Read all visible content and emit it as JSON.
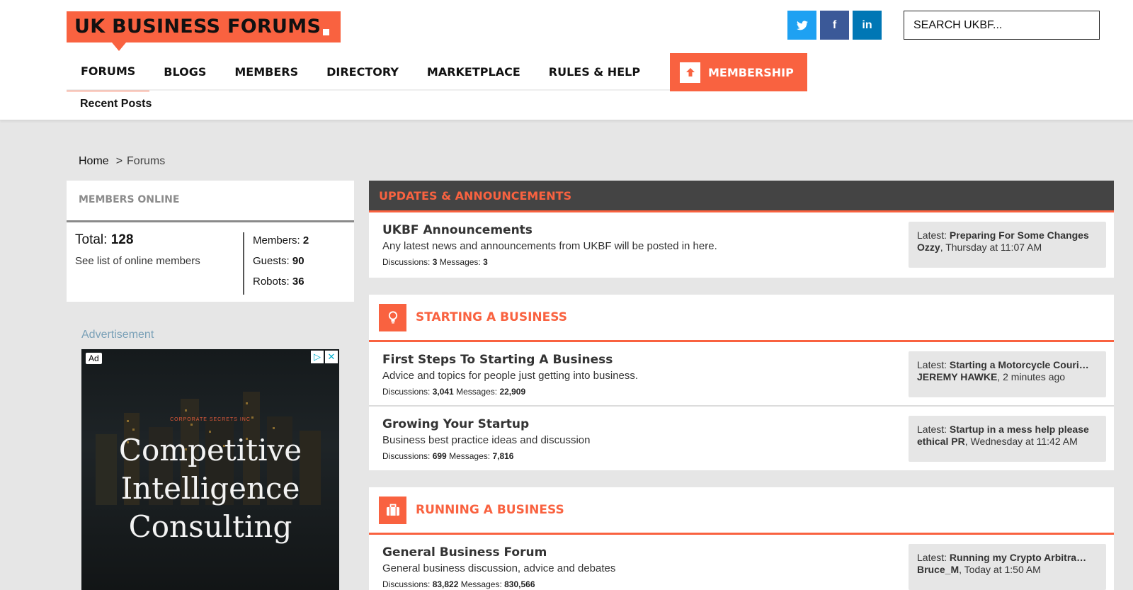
{
  "header": {
    "logo_text": "UK BUSINESS FORUMS",
    "social": {
      "twitter": "t",
      "facebook": "f",
      "linkedin": "in"
    },
    "search_placeholder": "SEARCH UKBF...",
    "nav": [
      {
        "label": "FORUMS"
      },
      {
        "label": "BLOGS"
      },
      {
        "label": "MEMBERS"
      },
      {
        "label": "DIRECTORY"
      },
      {
        "label": "MARKETPLACE"
      },
      {
        "label": "RULES & HELP"
      }
    ],
    "membership_label": "MEMBERSHIP",
    "membership_icon": "arrow-up-icon",
    "subnav": "Recent Posts",
    "accent_color": "#f96240"
  },
  "breadcrumb": {
    "home": "Home",
    "separator": ">",
    "current": "Forums"
  },
  "members_online": {
    "title": "MEMBERS ONLINE",
    "total_label": "Total:",
    "total_value": "128",
    "link": "See list of online members",
    "members_label": "Members:",
    "members_value": "2",
    "guests_label": "Guests:",
    "guests_value": "90",
    "robots_label": "Robots:",
    "robots_value": "36"
  },
  "advertisement": {
    "label": "Advertisement",
    "badge": "Ad",
    "company": "CORPORATE SECRETS INC",
    "line1": "Competitive",
    "line2": "Intelligence",
    "line3": "Consulting"
  },
  "categories": [
    {
      "title": "UPDATES & ANNOUNCEMENTS",
      "forums": [
        {
          "title": "UKBF Announcements",
          "description": "Any latest news and announcements from UKBF will be posted in here.",
          "disc_label": "Discussions:",
          "discussions": "3",
          "msg_label": "Messages:",
          "messages": "3",
          "latest_label": "Latest:",
          "latest_title": "Preparing For Some Changes",
          "latest_user": "Ozzy",
          "latest_time": ", Thursday at 11:07 AM"
        }
      ]
    },
    {
      "title": "STARTING A BUSINESS",
      "icon": "lightbulb-icon",
      "forums": [
        {
          "title": "First Steps To Starting A Business",
          "description": "Advice and topics for people just getting into business.",
          "disc_label": "Discussions:",
          "discussions": "3,041",
          "msg_label": "Messages:",
          "messages": "22,909",
          "latest_label": "Latest:",
          "latest_title": "Starting a Motorcycle Couri…",
          "latest_user": "JEREMY HAWKE",
          "latest_time": ", 2 minutes ago"
        },
        {
          "title": "Growing Your Startup",
          "description": "Business best practice ideas and discussion",
          "disc_label": "Discussions:",
          "discussions": "699",
          "msg_label": "Messages:",
          "messages": "7,816",
          "latest_label": "Latest:",
          "latest_title": "Startup in a mess help please",
          "latest_user": "ethical PR",
          "latest_time": ", Wednesday at 11:42 AM"
        }
      ]
    },
    {
      "title": "RUNNING A BUSINESS",
      "icon": "briefcase-icon",
      "forums": [
        {
          "title": "General Business Forum",
          "description": "General business discussion, advice and debates",
          "disc_label": "Discussions:",
          "discussions": "83,822",
          "msg_label": "Messages:",
          "messages": "830,566",
          "latest_label": "Latest:",
          "latest_title": "Running my Crypto Arbitra…",
          "latest_user": "Bruce_M",
          "latest_time": ", Today at 1:50 AM"
        }
      ]
    }
  ]
}
